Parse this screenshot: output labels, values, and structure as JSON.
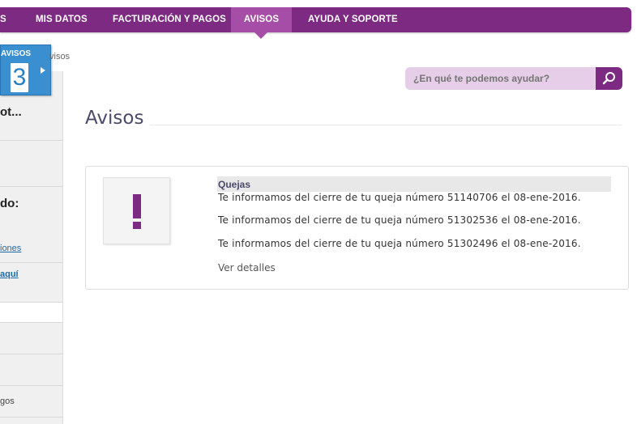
{
  "nav": {
    "items": [
      {
        "label": "S"
      },
      {
        "label": "MIS DATOS"
      },
      {
        "label": "FACTURACIÓN Y PAGOS"
      },
      {
        "label": "AVISOS"
      },
      {
        "label": "AYUDA Y SOPORTE"
      }
    ],
    "active_color": "#a64da8",
    "bar_color": "#7d2a83"
  },
  "badge": {
    "label": "AVISOS",
    "count": "3"
  },
  "breadcrumb": "visos",
  "sidebar": {
    "items": [
      {
        "text": "ot..."
      },
      {
        "text": "do:"
      },
      {
        "text": "iones"
      },
      {
        "text": "aquí"
      },
      {
        "text": "gos"
      }
    ]
  },
  "search": {
    "placeholder": "¿En qué te podemos ayudar?",
    "icon": "search-icon"
  },
  "page": {
    "title": "Avisos"
  },
  "notice": {
    "icon": "exclamation-icon",
    "category": "Quejas",
    "messages": [
      "Te informamos del cierre de tu queja número 51140706 el 08-ene-2016.",
      "Te informamos del cierre de tu queja número 51302536 el 08-ene-2016.",
      "Te informamos del cierre de tu queja número 51302496 el 08-ene-2016."
    ],
    "details_label": "Ver detalles"
  }
}
